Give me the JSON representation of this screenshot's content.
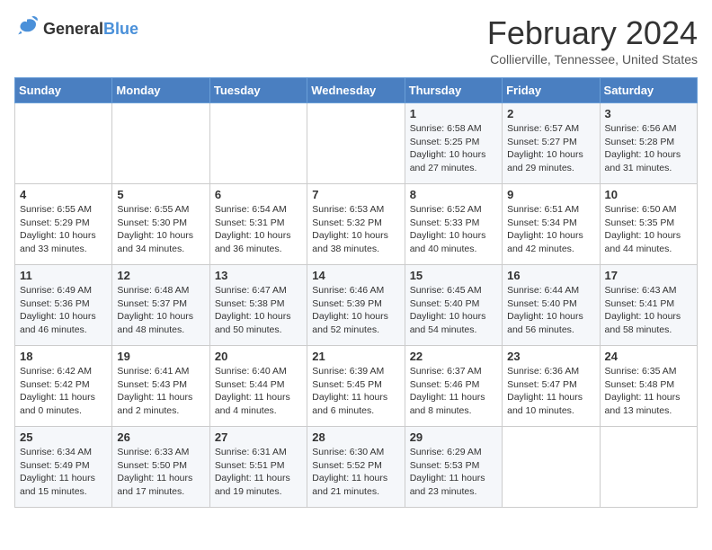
{
  "logo": {
    "line1": "General",
    "line2": "Blue"
  },
  "title": "February 2024",
  "subtitle": "Collierville, Tennessee, United States",
  "days_of_week": [
    "Sunday",
    "Monday",
    "Tuesday",
    "Wednesday",
    "Thursday",
    "Friday",
    "Saturday"
  ],
  "weeks": [
    [
      {
        "day": "",
        "info": ""
      },
      {
        "day": "",
        "info": ""
      },
      {
        "day": "",
        "info": ""
      },
      {
        "day": "",
        "info": ""
      },
      {
        "day": "1",
        "info": "Sunrise: 6:58 AM\nSunset: 5:25 PM\nDaylight: 10 hours\nand 27 minutes."
      },
      {
        "day": "2",
        "info": "Sunrise: 6:57 AM\nSunset: 5:27 PM\nDaylight: 10 hours\nand 29 minutes."
      },
      {
        "day": "3",
        "info": "Sunrise: 6:56 AM\nSunset: 5:28 PM\nDaylight: 10 hours\nand 31 minutes."
      }
    ],
    [
      {
        "day": "4",
        "info": "Sunrise: 6:55 AM\nSunset: 5:29 PM\nDaylight: 10 hours\nand 33 minutes."
      },
      {
        "day": "5",
        "info": "Sunrise: 6:55 AM\nSunset: 5:30 PM\nDaylight: 10 hours\nand 34 minutes."
      },
      {
        "day": "6",
        "info": "Sunrise: 6:54 AM\nSunset: 5:31 PM\nDaylight: 10 hours\nand 36 minutes."
      },
      {
        "day": "7",
        "info": "Sunrise: 6:53 AM\nSunset: 5:32 PM\nDaylight: 10 hours\nand 38 minutes."
      },
      {
        "day": "8",
        "info": "Sunrise: 6:52 AM\nSunset: 5:33 PM\nDaylight: 10 hours\nand 40 minutes."
      },
      {
        "day": "9",
        "info": "Sunrise: 6:51 AM\nSunset: 5:34 PM\nDaylight: 10 hours\nand 42 minutes."
      },
      {
        "day": "10",
        "info": "Sunrise: 6:50 AM\nSunset: 5:35 PM\nDaylight: 10 hours\nand 44 minutes."
      }
    ],
    [
      {
        "day": "11",
        "info": "Sunrise: 6:49 AM\nSunset: 5:36 PM\nDaylight: 10 hours\nand 46 minutes."
      },
      {
        "day": "12",
        "info": "Sunrise: 6:48 AM\nSunset: 5:37 PM\nDaylight: 10 hours\nand 48 minutes."
      },
      {
        "day": "13",
        "info": "Sunrise: 6:47 AM\nSunset: 5:38 PM\nDaylight: 10 hours\nand 50 minutes."
      },
      {
        "day": "14",
        "info": "Sunrise: 6:46 AM\nSunset: 5:39 PM\nDaylight: 10 hours\nand 52 minutes."
      },
      {
        "day": "15",
        "info": "Sunrise: 6:45 AM\nSunset: 5:40 PM\nDaylight: 10 hours\nand 54 minutes."
      },
      {
        "day": "16",
        "info": "Sunrise: 6:44 AM\nSunset: 5:40 PM\nDaylight: 10 hours\nand 56 minutes."
      },
      {
        "day": "17",
        "info": "Sunrise: 6:43 AM\nSunset: 5:41 PM\nDaylight: 10 hours\nand 58 minutes."
      }
    ],
    [
      {
        "day": "18",
        "info": "Sunrise: 6:42 AM\nSunset: 5:42 PM\nDaylight: 11 hours\nand 0 minutes."
      },
      {
        "day": "19",
        "info": "Sunrise: 6:41 AM\nSunset: 5:43 PM\nDaylight: 11 hours\nand 2 minutes."
      },
      {
        "day": "20",
        "info": "Sunrise: 6:40 AM\nSunset: 5:44 PM\nDaylight: 11 hours\nand 4 minutes."
      },
      {
        "day": "21",
        "info": "Sunrise: 6:39 AM\nSunset: 5:45 PM\nDaylight: 11 hours\nand 6 minutes."
      },
      {
        "day": "22",
        "info": "Sunrise: 6:37 AM\nSunset: 5:46 PM\nDaylight: 11 hours\nand 8 minutes."
      },
      {
        "day": "23",
        "info": "Sunrise: 6:36 AM\nSunset: 5:47 PM\nDaylight: 11 hours\nand 10 minutes."
      },
      {
        "day": "24",
        "info": "Sunrise: 6:35 AM\nSunset: 5:48 PM\nDaylight: 11 hours\nand 13 minutes."
      }
    ],
    [
      {
        "day": "25",
        "info": "Sunrise: 6:34 AM\nSunset: 5:49 PM\nDaylight: 11 hours\nand 15 minutes."
      },
      {
        "day": "26",
        "info": "Sunrise: 6:33 AM\nSunset: 5:50 PM\nDaylight: 11 hours\nand 17 minutes."
      },
      {
        "day": "27",
        "info": "Sunrise: 6:31 AM\nSunset: 5:51 PM\nDaylight: 11 hours\nand 19 minutes."
      },
      {
        "day": "28",
        "info": "Sunrise: 6:30 AM\nSunset: 5:52 PM\nDaylight: 11 hours\nand 21 minutes."
      },
      {
        "day": "29",
        "info": "Sunrise: 6:29 AM\nSunset: 5:53 PM\nDaylight: 11 hours\nand 23 minutes."
      },
      {
        "day": "",
        "info": ""
      },
      {
        "day": "",
        "info": ""
      }
    ]
  ]
}
